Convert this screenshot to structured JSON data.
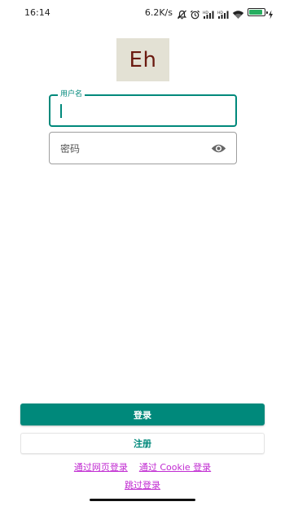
{
  "status_bar": {
    "time": "16:14",
    "network_speed": "6.2K/s",
    "battery_level": 0.9,
    "icons": [
      "mute-icon",
      "alarm-icon",
      "signal-icon",
      "signal-icon",
      "wifi-icon",
      "battery-icon",
      "charging-icon"
    ]
  },
  "logo": {
    "text": "Eh"
  },
  "form": {
    "username": {
      "label": "用户名",
      "value": ""
    },
    "password": {
      "placeholder": "密码",
      "value": ""
    }
  },
  "buttons": {
    "login_label": "登录",
    "register_label": "注册"
  },
  "links": {
    "web_login": "通过网页登录",
    "cookie_login": "通过 Cookie 登录",
    "skip_login": "跳过登录"
  },
  "colors": {
    "accent": "#00897b",
    "link": "#c02ad1",
    "logo_bg": "#e3e1d4",
    "logo_text": "#6b1a10"
  }
}
